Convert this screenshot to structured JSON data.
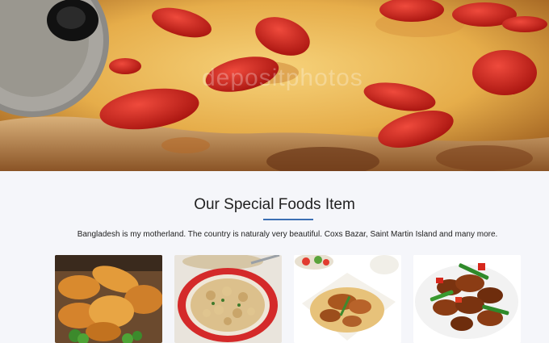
{
  "hero": {
    "image_alt": "pizza with tomato slices and melted cheese",
    "watermark": "depositphotos"
  },
  "section": {
    "title": "Our Special Foods Item",
    "description": "Bangladesh is my motherland. The country is naturaly very beautiful. Coxs Bazar, Saint Martin Island and many more."
  },
  "foods": [
    {
      "name": "fried chicken"
    },
    {
      "name": "pasta shells bowl"
    },
    {
      "name": "chicken biryani"
    },
    {
      "name": "chili chicken"
    }
  ],
  "colors": {
    "accent_underline": "#3b6fb3",
    "page_background": "#f5f6fa"
  }
}
